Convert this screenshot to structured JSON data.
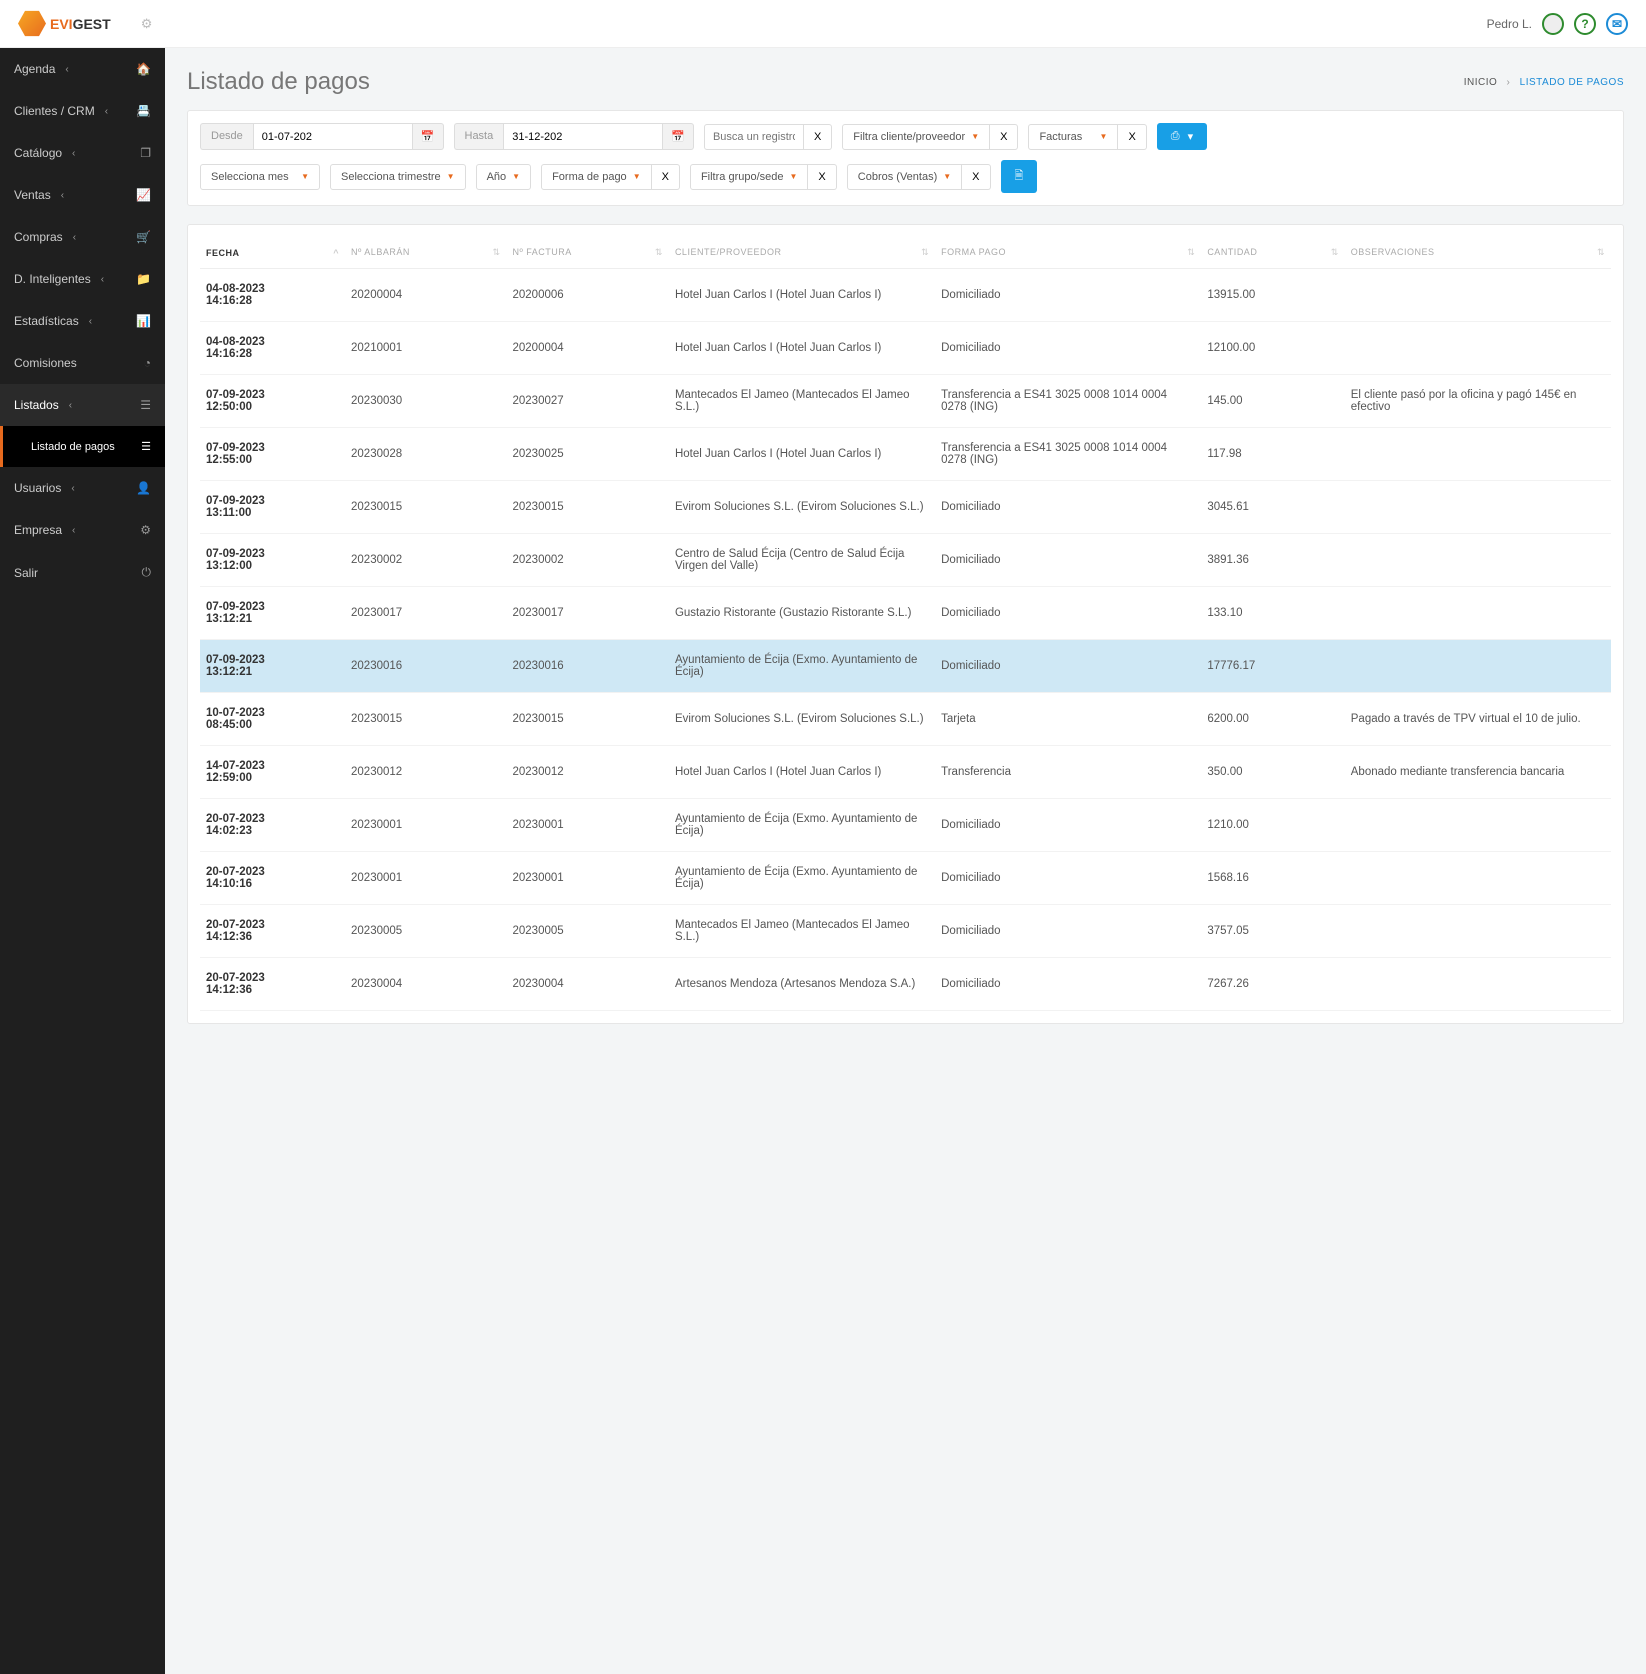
{
  "brand": {
    "pre": "EVI",
    "post": "GEST"
  },
  "user": {
    "name": "Pedro L."
  },
  "sidebar": {
    "items": [
      {
        "label": "Agenda",
        "icon": "🏠"
      },
      {
        "label": "Clientes / CRM",
        "icon": "📇"
      },
      {
        "label": "Catálogo",
        "icon": "❐"
      },
      {
        "label": "Ventas",
        "icon": "📈"
      },
      {
        "label": "Compras",
        "icon": "🛒"
      },
      {
        "label": "D. Inteligentes",
        "icon": "📁"
      },
      {
        "label": "Estadísticas",
        "icon": "📊"
      },
      {
        "label": "Comisiones",
        "icon": "◔"
      },
      {
        "label": "Listados",
        "icon": "☰",
        "active": true
      },
      {
        "label": "Usuarios",
        "icon": "👤"
      },
      {
        "label": "Empresa",
        "icon": "⚙"
      },
      {
        "label": "Salir",
        "icon": "⏻"
      }
    ],
    "sub": {
      "label": "Listado de pagos",
      "icon": "☰"
    }
  },
  "header": {
    "title": "Listado de pagos",
    "crumb_home": "INICIO",
    "crumb_here": "LISTADO DE PAGOS"
  },
  "filters": {
    "from_lbl": "Desde",
    "from": "01-07-202",
    "to_lbl": "Hasta",
    "to": "31-12-202",
    "search_ph": "Busca un registro",
    "x": "X",
    "cliente": "Filtra cliente/proveedor",
    "facturas": "Facturas",
    "mes": "Selecciona mes",
    "trimestre": "Selecciona trimestre",
    "anyo": "Año",
    "forma": "Forma de pago",
    "grupo": "Filtra grupo/sede",
    "cobros": "Cobros (Ventas)",
    "print": "⎙",
    "caret": "▾",
    "excel": "🗎"
  },
  "table": {
    "cols": {
      "fecha": "Fecha",
      "albaran": "Nº Albarán",
      "factura": "Nº Factura",
      "cliente": "Cliente/Proveedor",
      "forma": "Forma Pago",
      "cantidad": "Cantidad",
      "obs": "Observaciones"
    },
    "rows": [
      {
        "fecha": "04-08-2023\n14:16:28",
        "alb": "20200004",
        "fac": "20200006",
        "cli": "Hotel Juan Carlos I (Hotel Juan Carlos I)",
        "forma": "Domiciliado",
        "cant": "13915.00",
        "obs": ""
      },
      {
        "fecha": "04-08-2023\n14:16:28",
        "alb": "20210001",
        "fac": "20200004",
        "cli": "Hotel Juan Carlos I (Hotel Juan Carlos I)",
        "forma": "Domiciliado",
        "cant": "12100.00",
        "obs": ""
      },
      {
        "fecha": "07-09-2023\n12:50:00",
        "alb": "20230030",
        "fac": "20230027",
        "cli": "Mantecados El Jameo (Mantecados El Jameo S.L.)",
        "forma": "Transferencia a ES41 3025 0008 1014 0004 0278 (ING)",
        "cant": "145.00",
        "obs": "El cliente pasó por la oficina y pagó 145€ en efectivo"
      },
      {
        "fecha": "07-09-2023\n12:55:00",
        "alb": "20230028",
        "fac": "20230025",
        "cli": "Hotel Juan Carlos I (Hotel Juan Carlos I)",
        "forma": "Transferencia a ES41 3025 0008 1014 0004 0278 (ING)",
        "cant": "117.98",
        "obs": ""
      },
      {
        "fecha": "07-09-2023\n13:11:00",
        "alb": "20230015",
        "fac": "20230015",
        "cli": "Evirom Soluciones S.L. (Evirom Soluciones S.L.)",
        "forma": "Domiciliado",
        "cant": "3045.61",
        "obs": ""
      },
      {
        "fecha": "07-09-2023\n13:12:00",
        "alb": "20230002",
        "fac": "20230002",
        "cli": "Centro de Salud Écija (Centro de Salud Écija Virgen del Valle)",
        "forma": "Domiciliado",
        "cant": "3891.36",
        "obs": ""
      },
      {
        "fecha": "07-09-2023\n13:12:21",
        "alb": "20230017",
        "fac": "20230017",
        "cli": "Gustazio Ristorante (Gustazio Ristorante S.L.)",
        "forma": "Domiciliado",
        "cant": "133.10",
        "obs": ""
      },
      {
        "fecha": "07-09-2023\n13:12:21",
        "alb": "20230016",
        "fac": "20230016",
        "cli": "Ayuntamiento de Écija (Exmo. Ayuntamiento de Écija)",
        "forma": "Domiciliado",
        "cant": "17776.17",
        "obs": "",
        "hl": true
      },
      {
        "fecha": "10-07-2023\n08:45:00",
        "alb": "20230015",
        "fac": "20230015",
        "cli": "Evirom Soluciones S.L. (Evirom Soluciones S.L.)",
        "forma": "Tarjeta",
        "cant": "6200.00",
        "obs": "Pagado a través de TPV virtual el 10 de julio."
      },
      {
        "fecha": "14-07-2023\n12:59:00",
        "alb": "20230012",
        "fac": "20230012",
        "cli": "Hotel Juan Carlos I (Hotel Juan Carlos I)",
        "forma": "Transferencia",
        "cant": "350.00",
        "obs": "Abonado mediante transferencia bancaria"
      },
      {
        "fecha": "20-07-2023\n14:02:23",
        "alb": "20230001",
        "fac": "20230001",
        "cli": "Ayuntamiento de Écija (Exmo. Ayuntamiento de Écija)",
        "forma": "Domiciliado",
        "cant": "1210.00",
        "obs": ""
      },
      {
        "fecha": "20-07-2023\n14:10:16",
        "alb": "20230001",
        "fac": "20230001",
        "cli": "Ayuntamiento de Écija (Exmo. Ayuntamiento de Écija)",
        "forma": "Domiciliado",
        "cant": "1568.16",
        "obs": ""
      },
      {
        "fecha": "20-07-2023\n14:12:36",
        "alb": "20230005",
        "fac": "20230005",
        "cli": "Mantecados El Jameo (Mantecados El Jameo S.L.)",
        "forma": "Domiciliado",
        "cant": "3757.05",
        "obs": ""
      },
      {
        "fecha": "20-07-2023\n14:12:36",
        "alb": "20230004",
        "fac": "20230004",
        "cli": "Artesanos Mendoza (Artesanos Mendoza S.A.)",
        "forma": "Domiciliado",
        "cant": "7267.26",
        "obs": ""
      }
    ]
  }
}
